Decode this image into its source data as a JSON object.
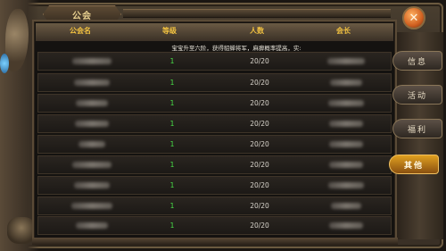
{
  "window": {
    "title": "公会",
    "close_glyph": "✕"
  },
  "notice": "宝宝升至六阶，获得貂蝉将军，麻痹概率提高，实:",
  "table": {
    "headers": [
      "公会名",
      "等级",
      "人数",
      "会长"
    ],
    "rows": [
      {
        "level": "1",
        "members": "20/20"
      },
      {
        "level": "1",
        "members": "20/20"
      },
      {
        "level": "1",
        "members": "20/20"
      },
      {
        "level": "1",
        "members": "20/20"
      },
      {
        "level": "1",
        "members": "20/20"
      },
      {
        "level": "1",
        "members": "20/20"
      },
      {
        "level": "1",
        "members": "20/20"
      },
      {
        "level": "1",
        "members": "20/20"
      },
      {
        "level": "1",
        "members": "20/20"
      }
    ]
  },
  "side_menu": [
    {
      "label": "信息",
      "active": false
    },
    {
      "label": "活动",
      "active": false
    },
    {
      "label": "福利",
      "active": false
    },
    {
      "label": "其他",
      "active": true
    }
  ],
  "colors": {
    "header_text": "#f0c040",
    "level_text": "#48e048",
    "accent": "#e0a020"
  }
}
